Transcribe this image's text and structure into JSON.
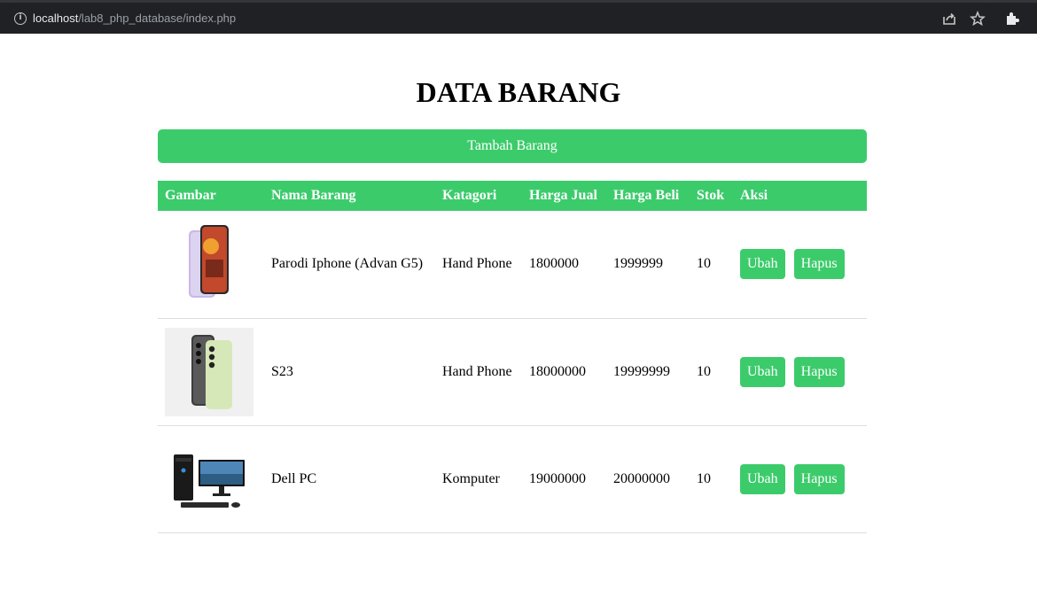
{
  "browser": {
    "url_host": "localhost",
    "url_path": "/lab8_php_database/index.php"
  },
  "page": {
    "title": "DATA BARANG",
    "add_button_label": "Tambah Barang"
  },
  "table": {
    "headers": [
      "Gambar",
      "Nama Barang",
      "Katagori",
      "Harga Jual",
      "Harga Beli",
      "Stok",
      "Aksi"
    ],
    "rows": [
      {
        "image": "phone-advan-g5-image",
        "name": "Parodi Iphone (Advan G5)",
        "category": "Hand Phone",
        "harga_jual": "1800000",
        "harga_beli": "1999999",
        "stok": "10",
        "edit_label": "Ubah",
        "delete_label": "Hapus"
      },
      {
        "image": "phone-s23-image",
        "name": "S23",
        "category": "Hand Phone",
        "harga_jual": "18000000",
        "harga_beli": "19999999",
        "stok": "10",
        "edit_label": "Ubah",
        "delete_label": "Hapus"
      },
      {
        "image": "dell-pc-image",
        "name": "Dell PC",
        "category": "Komputer",
        "harga_jual": "19000000",
        "harga_beli": "20000000",
        "stok": "10",
        "edit_label": "Ubah",
        "delete_label": "Hapus"
      }
    ]
  },
  "colors": {
    "accent": "#3ccb6b",
    "browser_bar": "#202124"
  }
}
